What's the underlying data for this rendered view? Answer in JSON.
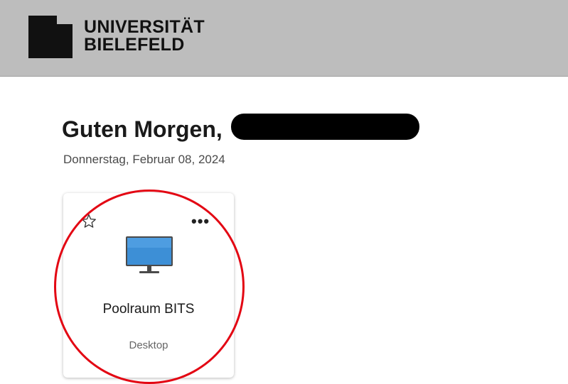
{
  "header": {
    "logo_line1": "UNIVERSITÄT",
    "logo_line2": "BIELEFELD",
    "logo_icon": "university-logo-mark"
  },
  "welcome": {
    "greeting": "Guten Morgen,",
    "date": "Donnerstag, Februar 08, 2024"
  },
  "tiles": [
    {
      "title": "Poolraum BITS",
      "type": "Desktop",
      "icons": {
        "favorite": "star-outline-icon",
        "more": "more-options-icon",
        "resource": "desktop-monitor-icon"
      },
      "more_glyph": "•••"
    }
  ],
  "colors": {
    "header_bg": "#bdbdbd",
    "highlight": "#e30613",
    "monitor_screen": "#3d8fd6"
  }
}
